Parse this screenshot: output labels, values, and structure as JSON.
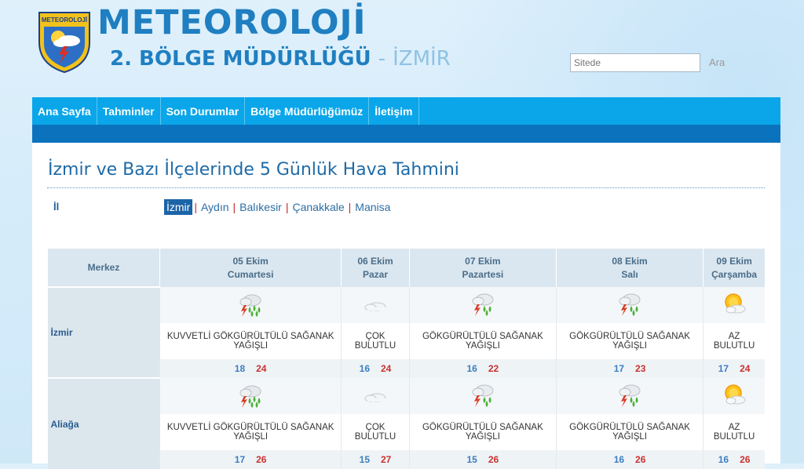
{
  "header": {
    "title": "METEOROLOJİ",
    "subtitle": "2. BÖLGE MÜDÜRLÜĞÜ",
    "dash": "-",
    "city": "İZMİR",
    "logo_text": "METEOROLOJİ",
    "search_placeholder": "Sitede",
    "search_button": "Ara"
  },
  "nav": [
    "Ana Sayfa",
    "Tahminler",
    "Son Durumlar",
    "Bölge Müdürlüğümüz",
    "İletişim"
  ],
  "page": {
    "title": "İzmir ve Bazı İlçelerinde 5 Günlük Hava Tahmini",
    "il_label": "İl",
    "provinces": [
      "İzmir",
      "Aydın",
      "Balıkesir",
      "Çanakkale",
      "Manisa"
    ],
    "active_province": "İzmir"
  },
  "forecast": {
    "merkez_header": "Merkez",
    "days": [
      {
        "date": "05 Ekim",
        "day": "Cumartesi"
      },
      {
        "date": "06 Ekim",
        "day": "Pazar"
      },
      {
        "date": "07 Ekim",
        "day": "Pazartesi"
      },
      {
        "date": "08 Ekim",
        "day": "Salı"
      },
      {
        "date": "09 Ekim",
        "day": "Çarşamba"
      }
    ],
    "rows": [
      {
        "city": "İzmir",
        "cells": [
          {
            "icon": "heavy-thunderstorm-icon",
            "desc": "KUVVETLİ GÖKGÜRÜLTÜLÜ SAĞANAK YAĞIŞLI",
            "min": "18",
            "max": "24"
          },
          {
            "icon": "cloudy-icon",
            "desc": "ÇOK BULUTLU",
            "min": "16",
            "max": "24"
          },
          {
            "icon": "thunderstorm-icon",
            "desc": "GÖKGÜRÜLTÜLÜ SAĞANAK YAĞIŞLI",
            "min": "16",
            "max": "22"
          },
          {
            "icon": "thunderstorm-icon",
            "desc": "GÖKGÜRÜLTÜLÜ SAĞANAK YAĞIŞLI",
            "min": "17",
            "max": "23"
          },
          {
            "icon": "partly-cloudy-icon",
            "desc": "AZ BULUTLU",
            "min": "17",
            "max": "24"
          }
        ]
      },
      {
        "city": "Aliağa",
        "cells": [
          {
            "icon": "heavy-thunderstorm-icon",
            "desc": "KUVVETLİ GÖKGÜRÜLTÜLÜ SAĞANAK YAĞIŞLI",
            "min": "17",
            "max": "26"
          },
          {
            "icon": "cloudy-icon",
            "desc": "ÇOK BULUTLU",
            "min": "15",
            "max": "27"
          },
          {
            "icon": "thunderstorm-icon",
            "desc": "GÖKGÜRÜLTÜLÜ SAĞANAK YAĞIŞLI",
            "min": "15",
            "max": "26"
          },
          {
            "icon": "thunderstorm-icon",
            "desc": "GÖKGÜRÜLTÜLÜ SAĞANAK YAĞIŞLI",
            "min": "16",
            "max": "26"
          },
          {
            "icon": "partly-cloudy-icon",
            "desc": "AZ BULUTLU",
            "min": "16",
            "max": "26"
          }
        ]
      }
    ]
  },
  "colors": {
    "brand_blue": "#1f7fc1",
    "nav_bg": "#0aa6e9",
    "subnav_bg": "#0b73bd",
    "temp_min": "#3b7ec2",
    "temp_max": "#c9312f"
  }
}
